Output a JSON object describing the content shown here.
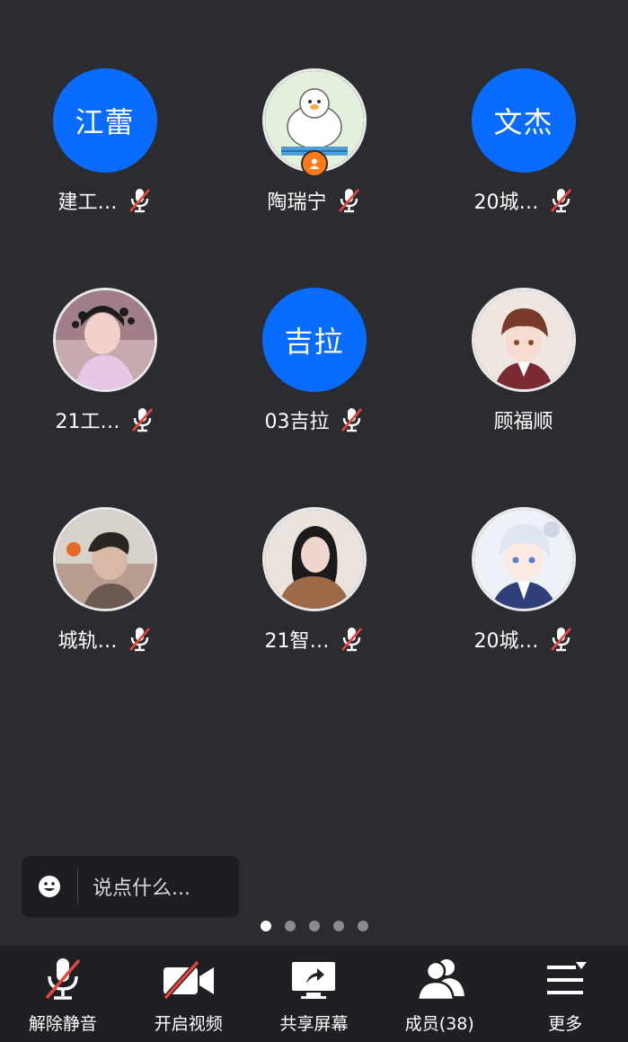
{
  "participants": [
    {
      "name": "建工…",
      "avatar_text": "江蕾",
      "avatar_type": "text",
      "muted": true
    },
    {
      "name": "陶瑞宁",
      "avatar_text": "",
      "avatar_type": "photo-cartoon-bird",
      "muted": true,
      "host": true
    },
    {
      "name": "20城…",
      "avatar_text": "文杰",
      "avatar_type": "text",
      "muted": true
    },
    {
      "name": "21工…",
      "avatar_text": "",
      "avatar_type": "photo-girl",
      "muted": true
    },
    {
      "name": "03吉拉",
      "avatar_text": "吉拉",
      "avatar_type": "text",
      "muted": true
    },
    {
      "name": "顾福顺",
      "avatar_text": "",
      "avatar_type": "photo-anime-boy",
      "muted": false
    },
    {
      "name": "城轨…",
      "avatar_text": "",
      "avatar_type": "photo-boy",
      "muted": true
    },
    {
      "name": "21智…",
      "avatar_text": "",
      "avatar_type": "photo-woman",
      "muted": true
    },
    {
      "name": "20城…",
      "avatar_text": "",
      "avatar_type": "photo-anime-white-hair",
      "muted": true
    }
  ],
  "chat": {
    "placeholder": "说点什么...",
    "icon": "emoji-icon"
  },
  "pager": {
    "pages": 5,
    "current": 1
  },
  "toolbar": {
    "unmute": {
      "label": "解除静音",
      "icon": "mic-muted-icon"
    },
    "video": {
      "label": "开启视频",
      "icon": "video-off-icon"
    },
    "share": {
      "label": "共享屏幕",
      "icon": "share-screen-icon"
    },
    "members": {
      "label": "成员(38)",
      "icon": "members-icon"
    },
    "more": {
      "label": "更多",
      "icon": "more-menu-icon"
    }
  },
  "colors": {
    "background": "#2b2c30",
    "toolbar": "#1f2023",
    "avatar_blue": "#0a6cff",
    "muted_red": "#e8443a",
    "host_badge": "#ff7a1a"
  }
}
